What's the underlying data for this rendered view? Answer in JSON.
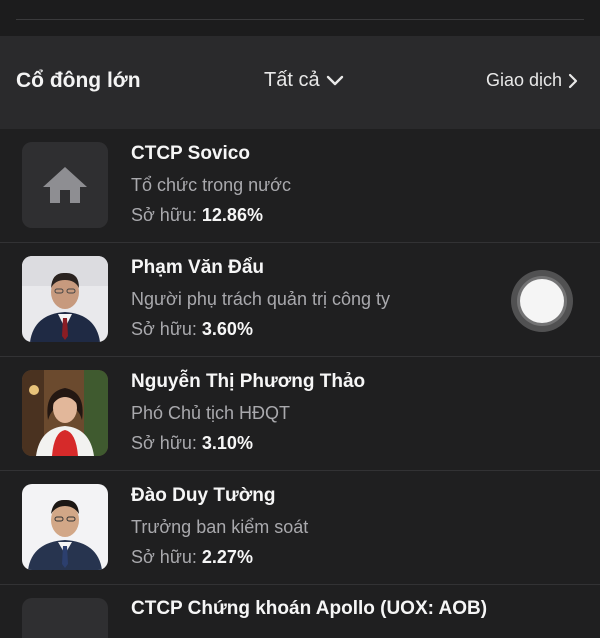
{
  "header": {
    "title": "Cổ đông lớn",
    "filter_label": "Tất cả",
    "filter_icon": "chevron-down-icon",
    "trade_label": "Giao dịch",
    "trade_icon": "chevron-right-icon"
  },
  "ownership_label": "Sở hữu:",
  "shareholders": [
    {
      "name": "CTCP Sovico",
      "role": "Tổ chức trong nước",
      "percent": "12.86%",
      "avatar": "home-icon"
    },
    {
      "name": "Phạm Văn Đẩu",
      "role": "Người phụ trách quản trị công ty",
      "percent": "3.60%",
      "avatar": "person-photo"
    },
    {
      "name": "Nguyễn Thị Phương Thảo",
      "role": "Phó Chủ tịch HĐQT",
      "percent": "3.10%",
      "avatar": "person-photo"
    },
    {
      "name": "Đào Duy Tường",
      "role": "Trưởng ban kiểm soát",
      "percent": "2.27%",
      "avatar": "person-photo"
    }
  ],
  "partial_row_name": "CTCP Chứng khoán Apollo (UOX: AOB)",
  "colors": {
    "background": "#1f1f20",
    "header_bg": "#2a2a2c",
    "secondary_text": "#a9a9ad",
    "primary_text": "#f6f6f6"
  }
}
